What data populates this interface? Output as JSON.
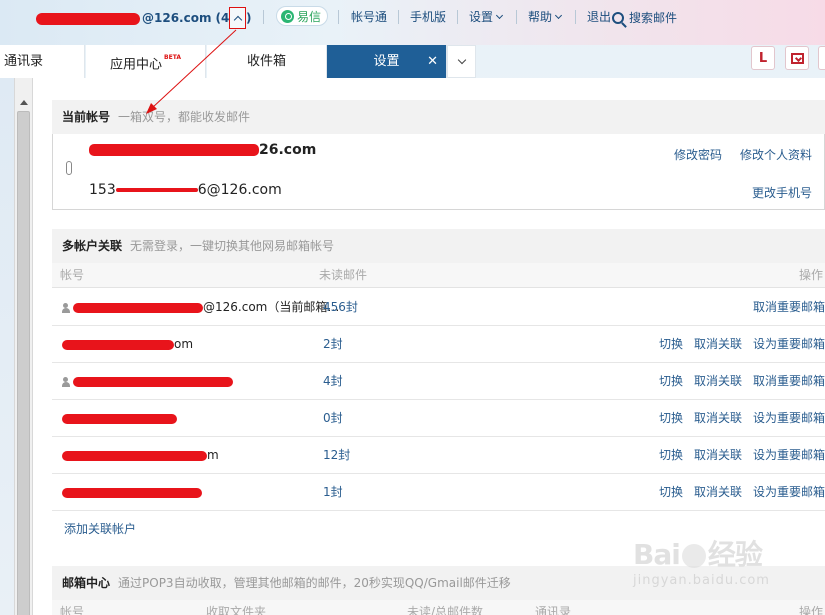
{
  "topbar": {
    "account_suffix": "@126.com",
    "unread_count": "(475)",
    "yixin_label": "易信",
    "links": [
      "帐号通",
      "手机版",
      "设置",
      "帮助",
      "退出"
    ],
    "search_label": "搜索邮件"
  },
  "tabs": [
    {
      "label": "通讯录",
      "badge": ""
    },
    {
      "label": "应用中心",
      "badge": "BETA"
    },
    {
      "label": "收件箱",
      "badge": ""
    },
    {
      "label": "设置",
      "badge": ""
    }
  ],
  "right_buttons": [
    "L"
  ],
  "current_account": {
    "title": "当前帐号",
    "subtitle": "一箱双号，都能收发邮件",
    "main_address_suffix": "26.com",
    "phone_address": "15330136116@126.com",
    "phone_prefix": "153",
    "phone_suffix": "6@126.com",
    "change_password": "修改密码",
    "edit_profile": "修改个人资料",
    "change_phone": "更改手机号"
  },
  "multi_account": {
    "title": "多帐户关联",
    "subtitle": "无需登录，一键切换其他网易邮箱帐号",
    "columns": {
      "account": "帐号",
      "unread": "未读邮件",
      "actions": "操作"
    },
    "rows": [
      {
        "email_suffix": "@126.com（当前邮箱…",
        "unread": "456封",
        "actions": [
          "取消重要邮箱"
        ]
      },
      {
        "email_suffix": "om",
        "unread": "2封",
        "actions": [
          "切换",
          "取消关联",
          "设为重要邮箱"
        ]
      },
      {
        "email_suffix": "",
        "unread": "4封",
        "actions": [
          "切换",
          "取消关联",
          "取消重要邮箱"
        ]
      },
      {
        "email_suffix": "",
        "unread": "0封",
        "actions": [
          "切换",
          "取消关联",
          "设为重要邮箱"
        ]
      },
      {
        "email_suffix": "m",
        "unread": "12封",
        "actions": [
          "切换",
          "取消关联",
          "设为重要邮箱"
        ]
      },
      {
        "email_suffix": "",
        "unread": "1封",
        "actions": [
          "切换",
          "取消关联",
          "设为重要邮箱"
        ]
      }
    ],
    "add_link": "添加关联帐户"
  },
  "mail_center": {
    "title": "邮箱中心",
    "subtitle": "通过POP3自动收取，管理其他邮箱的邮件，20秒实现QQ/Gmail邮件迁移",
    "columns": [
      "帐号",
      "收取文件夹",
      "未读/总邮件数",
      "通讯录",
      "操作"
    ]
  },
  "watermark": {
    "brand_left": "Bai",
    "brand_right": "经验",
    "url": "jingyan.baidu.com"
  },
  "colors": {
    "accent": "#1f5f97",
    "link": "#2a5d8f",
    "annotation": "#d11"
  }
}
